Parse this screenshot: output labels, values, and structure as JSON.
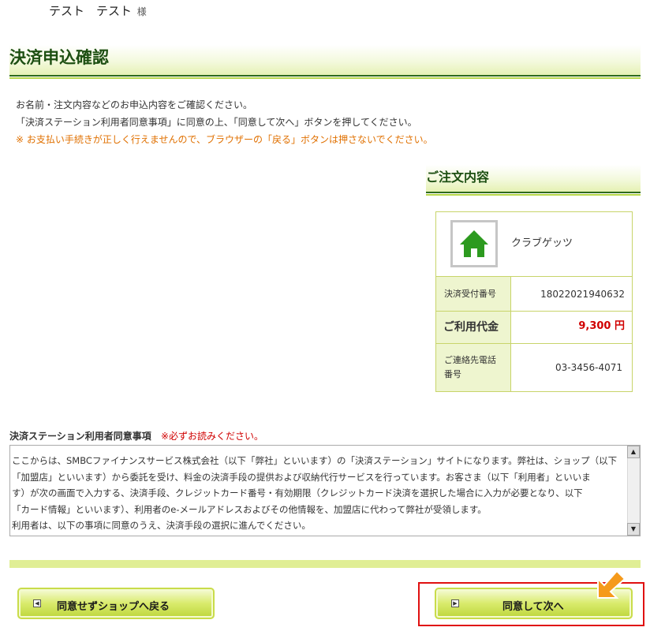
{
  "header": {
    "user_name": "テスト　テスト",
    "honorific": "様"
  },
  "page": {
    "title": "決済申込確認"
  },
  "intro": {
    "line1": "お名前・注文内容などのお申込内容をご確認ください。",
    "line2": "「決済ステーション利用者同意事項」に同意の上、「同意して次へ」ボタンを押してください。",
    "warning": "※ お支払い手続きが正しく行えませんので、ブラウザーの「戻る」ボタンは押さないでください。"
  },
  "order": {
    "section_title": "ご注文内容",
    "shop_icon": "home-icon",
    "shop_name": "クラブゲッツ",
    "receipt_label": "決済受付番号",
    "receipt_value": "18022021940632",
    "fee_label": "ご利用代金",
    "fee_value": "9,300 円",
    "phone_label_1": "ご連絡先電話",
    "phone_label_2": "番号",
    "phone_value": "03-3456-4071"
  },
  "consent": {
    "heading": "決済ステーション利用者同意事項",
    "required_note": "※必ずお読みください。",
    "lines": [
      "ここからは、SMBCファイナンスサービス株式会社（以下「弊社」といいます）の「決済ステーション」サイトになります。弊社は、ショップ（以下",
      "「加盟店」といいます）から委託を受け、料金の決済手段の提供および収納代行サービスを行っています。お客さま（以下「利用者」といいま",
      "す）が次の画面で入力する、決済手段、クレジットカード番号・有効期限（クレジットカード決済を選択した場合に入力が必要となり、以下",
      "「カード情報」といいます）、利用者のe-メールアドレスおよびその他情報を、加盟店に代わって弊社が受領します。",
      "利用者は、以下の事項に同意のうえ、決済手段の選択に進んでください。"
    ]
  },
  "buttons": {
    "back_label": "同意せずショップへ戻る",
    "next_label": "同意して次へ"
  },
  "colors": {
    "heading_green": "#1d4f12",
    "accent_lime": "#c9dc4a",
    "warning_orange": "#e07000",
    "alert_red": "#d00000",
    "highlight_red": "#e01010",
    "pointer_orange": "#f59a1b"
  }
}
